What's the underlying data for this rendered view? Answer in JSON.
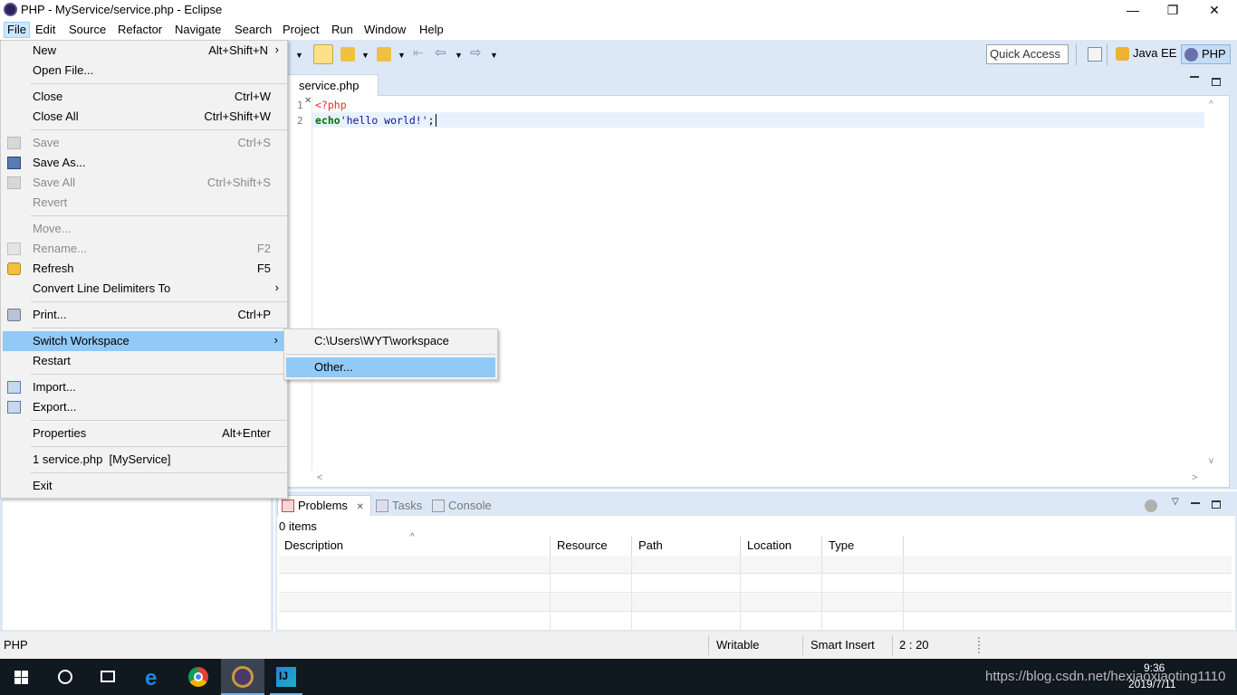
{
  "window": {
    "title": "PHP - MyService/service.php - Eclipse",
    "minimize": "—",
    "restore": "❐",
    "close": "✕"
  },
  "menubar": [
    "File",
    "Edit",
    "Source",
    "Refactor",
    "Navigate",
    "Search",
    "Project",
    "Run",
    "Window",
    "Help"
  ],
  "toolbar": {
    "quick_access_placeholder": "Quick Access",
    "perspectives": [
      {
        "label": "Java EE",
        "icon": "java-ee-perspective-icon"
      },
      {
        "label": "PHP",
        "icon": "php-perspective-icon",
        "active": true
      }
    ]
  },
  "editor": {
    "tab_label": "service.php",
    "tab_close": "✕",
    "lines": [
      {
        "num": "1",
        "text": "<?php"
      },
      {
        "num": "2",
        "keyword": "echo",
        "string": "'hello world!'",
        "tail": ";"
      }
    ],
    "hscroll_left": "<",
    "hscroll_right": ">",
    "vscroll_up": "^",
    "vscroll_down": "v"
  },
  "file_menu": {
    "items": [
      {
        "label": "New",
        "shortcut": "Alt+Shift+N",
        "submenu": true
      },
      {
        "label": "Open File..."
      },
      {
        "sep": true
      },
      {
        "label": "Close",
        "shortcut": "Ctrl+W"
      },
      {
        "label": "Close All",
        "shortcut": "Ctrl+Shift+W"
      },
      {
        "sep": true
      },
      {
        "label": "Save",
        "shortcut": "Ctrl+S",
        "disabled": true,
        "icon": "save-icon"
      },
      {
        "label": "Save As...",
        "icon": "save-as-icon"
      },
      {
        "label": "Save All",
        "shortcut": "Ctrl+Shift+S",
        "disabled": true,
        "icon": "save-all-icon"
      },
      {
        "label": "Revert",
        "disabled": true
      },
      {
        "sep": true
      },
      {
        "label": "Move...",
        "disabled": true
      },
      {
        "label": "Rename...",
        "shortcut": "F2",
        "disabled": true,
        "icon": "rename-icon"
      },
      {
        "label": "Refresh",
        "shortcut": "F5",
        "icon": "refresh-icon"
      },
      {
        "label": "Convert Line Delimiters To",
        "submenu": true
      },
      {
        "sep": true
      },
      {
        "label": "Print...",
        "shortcut": "Ctrl+P",
        "icon": "print-icon"
      },
      {
        "sep": true
      },
      {
        "label": "Switch Workspace",
        "submenu": true,
        "highlighted": true
      },
      {
        "label": "Restart"
      },
      {
        "sep": true
      },
      {
        "label": "Import...",
        "icon": "import-icon"
      },
      {
        "label": "Export...",
        "icon": "export-icon"
      },
      {
        "sep": true
      },
      {
        "label": "Properties",
        "shortcut": "Alt+Enter"
      },
      {
        "sep": true
      },
      {
        "label": "1 service.php  [MyService]"
      },
      {
        "sep": true
      },
      {
        "label": "Exit"
      }
    ]
  },
  "switch_workspace_menu": {
    "items": [
      {
        "label": "C:\\Users\\WYT\\workspace"
      },
      {
        "label": "Other...",
        "highlighted": true
      }
    ]
  },
  "bottom_panel": {
    "tabs": [
      {
        "label": "Problems",
        "active": true,
        "icon": "problems-icon",
        "close": "✕"
      },
      {
        "label": "Tasks",
        "icon": "tasks-icon"
      },
      {
        "label": "Console",
        "icon": "console-icon"
      }
    ],
    "item_count": "0 items",
    "columns": [
      "Description",
      "Resource",
      "Path",
      "Location",
      "Type"
    ]
  },
  "statusbar": {
    "perspective": "PHP",
    "writable": "Writable",
    "insert_mode": "Smart Insert",
    "position": "2 : 20"
  },
  "taskbar": {
    "time": "9:36",
    "date": "2019/7/11",
    "watermark": "https://blog.csdn.net/hexiaoxiaoting1110",
    "apps": [
      "start-icon",
      "search-icon",
      "task-view-icon",
      "edge-icon",
      "chrome-icon",
      "eclipse-icon",
      "intellij-icon"
    ]
  }
}
